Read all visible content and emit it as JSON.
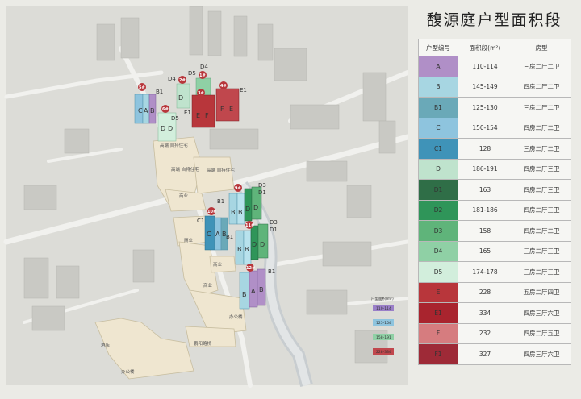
{
  "title": "馥源庭户型面积段",
  "table": {
    "headers": [
      "户型编号",
      "面积段(m²)",
      "房型"
    ],
    "rows": [
      {
        "code": "A",
        "area": "110-114",
        "layout": "三房二厅二卫",
        "color": "#b08fc7"
      },
      {
        "code": "B",
        "area": "145-149",
        "layout": "四房二厅二卫",
        "color": "#a7d6e2"
      },
      {
        "code": "B1",
        "area": "125-130",
        "layout": "三房二厅二卫",
        "color": "#6aa9b8"
      },
      {
        "code": "C",
        "area": "150-154",
        "layout": "四房二厅二卫",
        "color": "#8ec4de"
      },
      {
        "code": "C1",
        "area": "128",
        "layout": "三房二厅二卫",
        "color": "#3f93b8"
      },
      {
        "code": "D",
        "area": "186-191",
        "layout": "四房二厅三卫",
        "color": "#bfe3cd"
      },
      {
        "code": "D1",
        "area": "163",
        "layout": "四房二厅三卫",
        "color": "#2f6e47"
      },
      {
        "code": "D2",
        "area": "181-186",
        "layout": "四房二厅三卫",
        "color": "#2f9559"
      },
      {
        "code": "D3",
        "area": "158",
        "layout": "四房二厅二卫",
        "color": "#5fb47a"
      },
      {
        "code": "D4",
        "area": "165",
        "layout": "三房二厅三卫",
        "color": "#8fd0a5"
      },
      {
        "code": "D5",
        "area": "174-178",
        "layout": "三房二厅三卫",
        "color": "#d2eedc"
      },
      {
        "code": "E",
        "area": "228",
        "layout": "五房二厅四卫",
        "color": "#b8363b"
      },
      {
        "code": "E1",
        "area": "334",
        "layout": "四房三厅六卫",
        "color": "#a9242e"
      },
      {
        "code": "F",
        "area": "232",
        "layout": "四房二厅五卫",
        "color": "#d67c7f"
      },
      {
        "code": "F1",
        "area": "327",
        "layout": "四房三厅六卫",
        "color": "#9e2a37"
      }
    ]
  },
  "map": {
    "labels": {
      "biz1": "商业",
      "biz2": "商业",
      "biz3": "商业",
      "biz4": "商业",
      "office1": "办公楼",
      "office2": "办公楼",
      "hotel": "酒店",
      "street": "鹏阳路桥",
      "res1": "高端\n自持住宅",
      "res2": "高端\n自持住宅",
      "res3": "高端\n自持住宅"
    },
    "building_numbers": [
      "5#",
      "2#",
      "1#",
      "4#",
      "3#",
      "6#",
      "9#",
      "10#",
      "11#",
      "12#"
    ],
    "unit_labels": [
      "B1",
      "D4",
      "D5",
      "D4",
      "E1",
      "D5",
      "E1",
      "D3",
      "D1",
      "B1",
      "C1",
      "D3",
      "D1",
      "B1",
      "B1"
    ],
    "legend": {
      "title": "户型面积(m²)",
      "items": [
        {
          "label": "110-114",
          "color": "#9a7fc8"
        },
        {
          "label": "125-154",
          "color": "#8ec4de"
        },
        {
          "label": "158-191",
          "color": "#8fd0a5"
        },
        {
          "label": "228-334",
          "color": "#c0474d"
        }
      ]
    }
  }
}
